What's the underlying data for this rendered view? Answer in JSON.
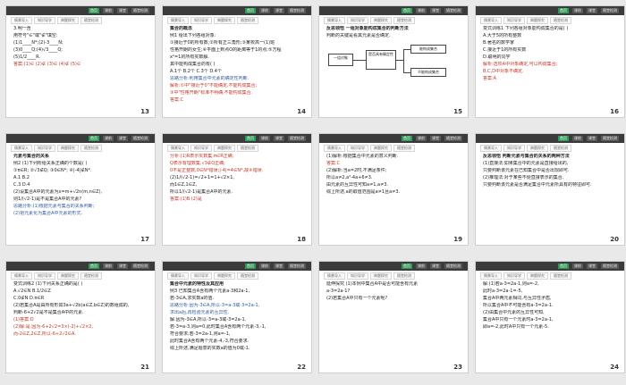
{
  "tabs": [
    "首页",
    "课前",
    "课堂",
    "随堂检测"
  ],
  "chips": [
    "情景导入",
    "知识导学",
    "典题探究",
    "随堂检测"
  ],
  "slides": [
    {
      "num": "13",
      "lines": [
        {
          "t": "3.明一含",
          "c": ""
        },
        {
          "t": "用符号\"∈\"或\"∉\"填空:",
          "c": ""
        },
        {
          "t": "(1)1____N*;(2)-3____N;",
          "c": ""
        },
        {
          "t": "(3)0____Q;(4)√3____Q;",
          "c": ""
        },
        {
          "t": "(5)1/2____R.",
          "c": ""
        },
        {
          "t": "答案:(1)∈ (2)∉ (3)∈ (4)∉ (5)∈",
          "c": "red"
        }
      ]
    },
    {
      "num": "14",
      "lines": [
        {
          "t": "集合的概念",
          "c": "bold"
        },
        {
          "t": "例1 给出下列各组对象:",
          "c": ""
        },
        {
          "t": "①接近于0的所有数;②所有正三角形;③某校高一(1)班",
          "c": ""
        },
        {
          "t": "性格开朗的女生;④平面上到点O的距离等于1的点;⑤方程",
          "c": ""
        },
        {
          "t": "x²=1的所有实数解.",
          "c": ""
        },
        {
          "t": "其中能构成集合的有(   )",
          "c": ""
        },
        {
          "t": "A.1个  B.2个  C.3个  D.4个",
          "c": ""
        },
        {
          "t": "思路分析:利用集合中元素的确定性判断.",
          "c": "blue"
        },
        {
          "t": "解析:①中\"接近于0\"不能确定,不能构成集合;",
          "c": "red"
        },
        {
          "t": "③中\"性格开朗\"标准不明确,不能构成集合.",
          "c": "red"
        },
        {
          "t": "答案:C",
          "c": "red"
        }
      ]
    },
    {
      "num": "15",
      "lines": [
        {
          "t": "反思领悟 一组对象能构成集合的判断方法",
          "c": "bold"
        },
        {
          "t": "判断的关键是看其元素是否确定.",
          "c": ""
        }
      ],
      "flow": [
        "一组对象",
        "是否具有确定性",
        "能构成集合",
        "不能构成集合"
      ]
    },
    {
      "num": "16",
      "lines": [
        {
          "t": "变式训练1 下列各组对象能构成集合的是(   )",
          "c": ""
        },
        {
          "t": "A.大于5的所有整数",
          "c": ""
        },
        {
          "t": "B.著名的数学家",
          "c": ""
        },
        {
          "t": "C.接近于1的所有实数",
          "c": ""
        },
        {
          "t": "D.聪明的同学",
          "c": ""
        },
        {
          "t": "解析:选项A中对象确定,可以构成集合;",
          "c": "red"
        },
        {
          "t": "B,C,D中对象不确定.",
          "c": "red"
        },
        {
          "t": "答案:A",
          "c": "red"
        }
      ]
    },
    {
      "num": "17",
      "lines": [
        {
          "t": "元素与集合的关系",
          "c": "bold"
        },
        {
          "t": "例2 (1)下列所给关系正确的个数是(   )",
          "c": ""
        },
        {
          "t": "①π∈R; ②√3∉Q; ③0∈N*; ④|-4|∉N*.",
          "c": ""
        },
        {
          "t": "A.1    B.2",
          "c": ""
        },
        {
          "t": "C.3    D.4",
          "c": ""
        },
        {
          "t": "(2)设集合A中的元素为x=m+√2n(m,n∈Z),",
          "c": ""
        },
        {
          "t": "则1/(√2-1)是不是集合A中的元素?",
          "c": ""
        },
        {
          "t": "思路分析:(1)根据元素与集合的关系判断;",
          "c": "blue"
        },
        {
          "t": "(2)把元素化为集合A中元素的形式.",
          "c": "blue"
        }
      ]
    },
    {
      "num": "18",
      "lines": [
        {
          "t": "分析:(1)R表示实数集,π∈R正确;",
          "c": "red"
        },
        {
          "t": "Q表示有理数集,√3∉Q正确;",
          "c": "red"
        },
        {
          "t": "0不是正整数,0∈N*错误;|-4|=4∈N*,故④错误.",
          "c": "red"
        },
        {
          "t": "(2)1/(√2-1)=√2+1=1+√2×1,",
          "c": ""
        },
        {
          "t": "而1∈Z,1∈Z,",
          "c": ""
        },
        {
          "t": "所以1/(√2-1)是集合A中的元素.",
          "c": ""
        },
        {
          "t": "答案:(1)B (2)是",
          "c": "red"
        }
      ]
    },
    {
      "num": "19",
      "lines": [
        {
          "t": "(1)解析:根据集合中元素的意义判断.",
          "c": ""
        },
        {
          "t": "答案:C",
          "c": "red"
        },
        {
          "t": "(2)解析:当a=2时,不满足条件;",
          "c": ""
        },
        {
          "t": "所以a≠2,a²-4a+6≠3.",
          "c": ""
        },
        {
          "t": "由元素的互异性可知a≠1,a≠3.",
          "c": ""
        },
        {
          "t": "综上所述,a的取值范围是a≠1且a≠3.",
          "c": ""
        }
      ]
    },
    {
      "num": "20",
      "lines": [
        {
          "t": "反思领悟 判断元素与集合的关系的两种方法",
          "c": "bold"
        },
        {
          "t": "(1)直接法:如果集合中的元素是直接给出的,",
          "c": ""
        },
        {
          "t": "只要判断该元素在已知集合中是否出现即可.",
          "c": ""
        },
        {
          "t": "(2)推理法:对于某些不便直接表示的集合,",
          "c": ""
        },
        {
          "t": "只要判断该元素是否满足集合中元素所具有的特征即可.",
          "c": ""
        }
      ]
    },
    {
      "num": "21",
      "lines": [
        {
          "t": "变式训练2 (1)下列关系正确的是(   )",
          "c": ""
        },
        {
          "t": "A.√2∈N    B.1/2∈Z",
          "c": ""
        },
        {
          "t": "C.0∉N    D.π∈R",
          "c": ""
        },
        {
          "t": "(2)若集合A是由所有形如3a+√2b(a∈Z,b∈Z)的数组成的,",
          "c": ""
        },
        {
          "t": "判断-6+2√2是不是集合A中的元素.",
          "c": ""
        },
        {
          "t": "(1)答案:D",
          "c": "red"
        },
        {
          "t": "(2)解:是.因为-6+2√2=3×(-2)+√2×2,",
          "c": "red"
        },
        {
          "t": "而-2∈Z,2∈Z,所以-6+2√2∈A.",
          "c": "red"
        }
      ]
    },
    {
      "num": "22",
      "lines": [
        {
          "t": "集合中元素的特性及其应用",
          "c": "bold"
        },
        {
          "t": "例3 已知集合A含有两个元素a-3和2a-1,",
          "c": ""
        },
        {
          "t": "若-3∈A,求实数a的值.",
          "c": ""
        },
        {
          "t": "思路分析:因为-3∈A,所以-3=a-3或-3=2a-1,",
          "c": "blue"
        },
        {
          "t": "求出a后,再检验元素的互异性.",
          "c": "blue"
        },
        {
          "t": "解:因为-3∈A,所以-3=a-3或-3=2a-1.",
          "c": ""
        },
        {
          "t": "若-3=a-3,则a=0,此时集合A含有两个元素-3,-1,",
          "c": ""
        },
        {
          "t": "符合要求;若-3=2a-1,则a=-1,",
          "c": ""
        },
        {
          "t": "此时集合A含有两个元素-4,-3,符合要求.",
          "c": ""
        },
        {
          "t": "综上所述,满足题意的实数a的值为0或-1.",
          "c": ""
        }
      ]
    },
    {
      "num": "23",
      "lines": [
        {
          "t": "延伸探究 (1)本例中集合A中是否可能含有元素",
          "c": ""
        },
        {
          "t": "a-3=2a-1?",
          "c": ""
        },
        {
          "t": "(2)若集合A中只有一个元素呢?",
          "c": ""
        }
      ]
    },
    {
      "num": "24",
      "lines": [
        {
          "t": "解:(1)若a-3=2a-1,则a=-2,",
          "c": ""
        },
        {
          "t": "此时a-3=2a-1=-5,",
          "c": ""
        },
        {
          "t": "集合A中两元素相同,与互异性矛盾,",
          "c": ""
        },
        {
          "t": "所以集合A中不可能含有a-3=2a-1.",
          "c": ""
        },
        {
          "t": "(2)由集合中元素的互异性可知,",
          "c": ""
        },
        {
          "t": "集合A中只有一个元素时a-3=2a-1,",
          "c": ""
        },
        {
          "t": "即a=-2,此时A中只有一个元素-5.",
          "c": ""
        }
      ]
    }
  ]
}
